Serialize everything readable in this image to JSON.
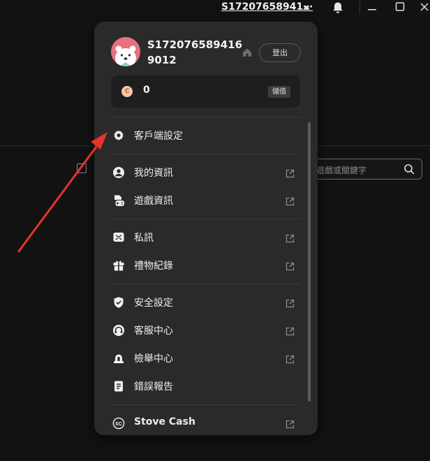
{
  "topbar": {
    "username": "S17207658941⋯",
    "bell_icon": "bell-icon",
    "window_controls": [
      "minimize-icon",
      "maximize-icon",
      "close-icon"
    ]
  },
  "background": {
    "search_placeholder": "遊戲或關鍵字",
    "search_icon": "search-icon"
  },
  "profile": {
    "username": "S1720765894169012",
    "logout_label": "登出",
    "avatar_icon": "polar-bear-avatar"
  },
  "wallet": {
    "coin_symbol": "C",
    "balance": "0",
    "topup_label": "儲值",
    "coin_color": "#f7c8a4"
  },
  "menu": {
    "client_settings": "客戶端設定",
    "my_info": "我的資訊",
    "game_info": "遊戲資訊",
    "messages": "私訊",
    "gift_history": "禮物紀錄",
    "security_settings": "安全設定",
    "customer_service": "客服中心",
    "report_center": "檢舉中心",
    "bug_report": "錯誤報告",
    "stove_cash": "Stove Cash"
  },
  "colors": {
    "panel_bg": "#2a2a2a",
    "page_bg": "#121212",
    "annotation_arrow": "#e8322c"
  }
}
